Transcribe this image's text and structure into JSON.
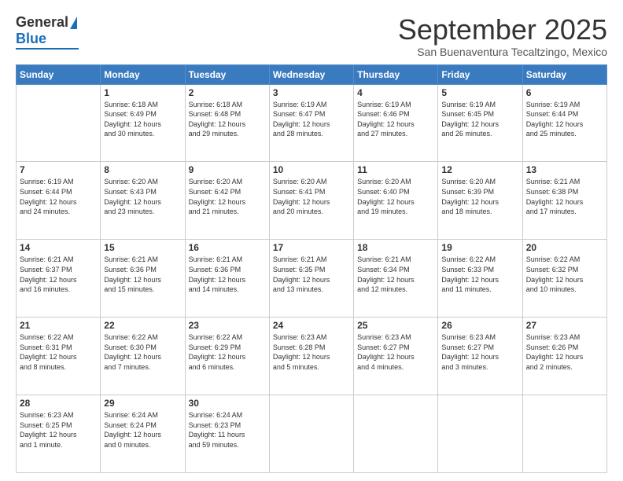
{
  "header": {
    "logo_general": "General",
    "logo_blue": "Blue",
    "month_title": "September 2025",
    "subtitle": "San Buenaventura Tecaltzingo, Mexico"
  },
  "weekdays": [
    "Sunday",
    "Monday",
    "Tuesday",
    "Wednesday",
    "Thursday",
    "Friday",
    "Saturday"
  ],
  "weeks": [
    [
      {
        "day": "",
        "info": ""
      },
      {
        "day": "1",
        "info": "Sunrise: 6:18 AM\nSunset: 6:49 PM\nDaylight: 12 hours\nand 30 minutes."
      },
      {
        "day": "2",
        "info": "Sunrise: 6:18 AM\nSunset: 6:48 PM\nDaylight: 12 hours\nand 29 minutes."
      },
      {
        "day": "3",
        "info": "Sunrise: 6:19 AM\nSunset: 6:47 PM\nDaylight: 12 hours\nand 28 minutes."
      },
      {
        "day": "4",
        "info": "Sunrise: 6:19 AM\nSunset: 6:46 PM\nDaylight: 12 hours\nand 27 minutes."
      },
      {
        "day": "5",
        "info": "Sunrise: 6:19 AM\nSunset: 6:45 PM\nDaylight: 12 hours\nand 26 minutes."
      },
      {
        "day": "6",
        "info": "Sunrise: 6:19 AM\nSunset: 6:44 PM\nDaylight: 12 hours\nand 25 minutes."
      }
    ],
    [
      {
        "day": "7",
        "info": "Sunrise: 6:19 AM\nSunset: 6:44 PM\nDaylight: 12 hours\nand 24 minutes."
      },
      {
        "day": "8",
        "info": "Sunrise: 6:20 AM\nSunset: 6:43 PM\nDaylight: 12 hours\nand 23 minutes."
      },
      {
        "day": "9",
        "info": "Sunrise: 6:20 AM\nSunset: 6:42 PM\nDaylight: 12 hours\nand 21 minutes."
      },
      {
        "day": "10",
        "info": "Sunrise: 6:20 AM\nSunset: 6:41 PM\nDaylight: 12 hours\nand 20 minutes."
      },
      {
        "day": "11",
        "info": "Sunrise: 6:20 AM\nSunset: 6:40 PM\nDaylight: 12 hours\nand 19 minutes."
      },
      {
        "day": "12",
        "info": "Sunrise: 6:20 AM\nSunset: 6:39 PM\nDaylight: 12 hours\nand 18 minutes."
      },
      {
        "day": "13",
        "info": "Sunrise: 6:21 AM\nSunset: 6:38 PM\nDaylight: 12 hours\nand 17 minutes."
      }
    ],
    [
      {
        "day": "14",
        "info": "Sunrise: 6:21 AM\nSunset: 6:37 PM\nDaylight: 12 hours\nand 16 minutes."
      },
      {
        "day": "15",
        "info": "Sunrise: 6:21 AM\nSunset: 6:36 PM\nDaylight: 12 hours\nand 15 minutes."
      },
      {
        "day": "16",
        "info": "Sunrise: 6:21 AM\nSunset: 6:36 PM\nDaylight: 12 hours\nand 14 minutes."
      },
      {
        "day": "17",
        "info": "Sunrise: 6:21 AM\nSunset: 6:35 PM\nDaylight: 12 hours\nand 13 minutes."
      },
      {
        "day": "18",
        "info": "Sunrise: 6:21 AM\nSunset: 6:34 PM\nDaylight: 12 hours\nand 12 minutes."
      },
      {
        "day": "19",
        "info": "Sunrise: 6:22 AM\nSunset: 6:33 PM\nDaylight: 12 hours\nand 11 minutes."
      },
      {
        "day": "20",
        "info": "Sunrise: 6:22 AM\nSunset: 6:32 PM\nDaylight: 12 hours\nand 10 minutes."
      }
    ],
    [
      {
        "day": "21",
        "info": "Sunrise: 6:22 AM\nSunset: 6:31 PM\nDaylight: 12 hours\nand 8 minutes."
      },
      {
        "day": "22",
        "info": "Sunrise: 6:22 AM\nSunset: 6:30 PM\nDaylight: 12 hours\nand 7 minutes."
      },
      {
        "day": "23",
        "info": "Sunrise: 6:22 AM\nSunset: 6:29 PM\nDaylight: 12 hours\nand 6 minutes."
      },
      {
        "day": "24",
        "info": "Sunrise: 6:23 AM\nSunset: 6:28 PM\nDaylight: 12 hours\nand 5 minutes."
      },
      {
        "day": "25",
        "info": "Sunrise: 6:23 AM\nSunset: 6:27 PM\nDaylight: 12 hours\nand 4 minutes."
      },
      {
        "day": "26",
        "info": "Sunrise: 6:23 AM\nSunset: 6:27 PM\nDaylight: 12 hours\nand 3 minutes."
      },
      {
        "day": "27",
        "info": "Sunrise: 6:23 AM\nSunset: 6:26 PM\nDaylight: 12 hours\nand 2 minutes."
      }
    ],
    [
      {
        "day": "28",
        "info": "Sunrise: 6:23 AM\nSunset: 6:25 PM\nDaylight: 12 hours\nand 1 minute."
      },
      {
        "day": "29",
        "info": "Sunrise: 6:24 AM\nSunset: 6:24 PM\nDaylight: 12 hours\nand 0 minutes."
      },
      {
        "day": "30",
        "info": "Sunrise: 6:24 AM\nSunset: 6:23 PM\nDaylight: 11 hours\nand 59 minutes."
      },
      {
        "day": "",
        "info": ""
      },
      {
        "day": "",
        "info": ""
      },
      {
        "day": "",
        "info": ""
      },
      {
        "day": "",
        "info": ""
      }
    ]
  ]
}
